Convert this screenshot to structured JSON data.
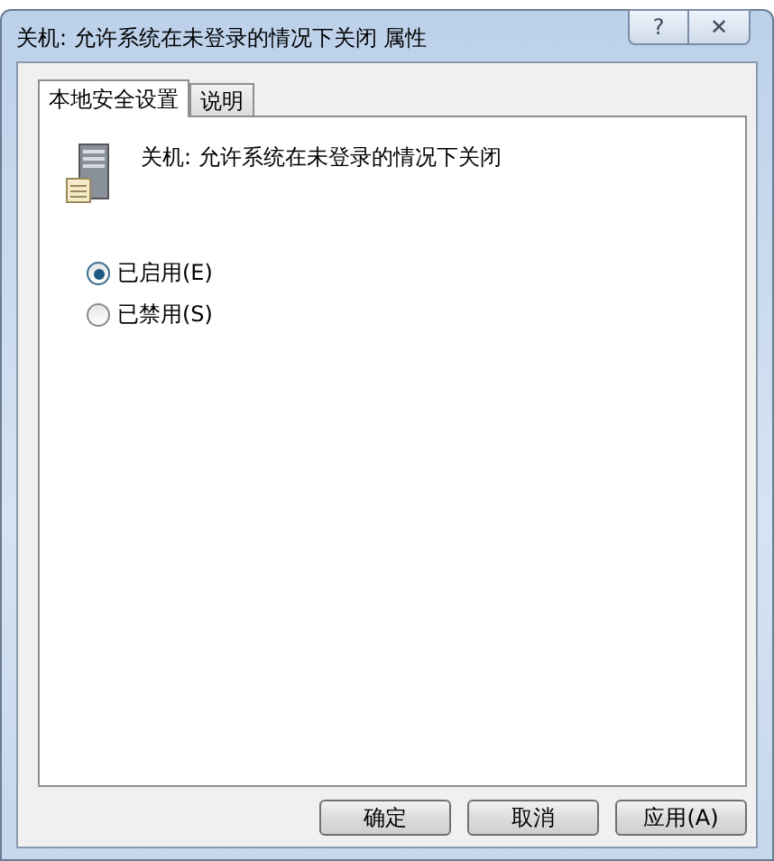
{
  "window": {
    "title": "关机: 允许系统在未登录的情况下关闭 属性",
    "title_buttons": [
      "?",
      "✕"
    ]
  },
  "tabs": [
    {
      "label": "本地安全设置",
      "selected": true
    },
    {
      "label": "说明",
      "selected": false
    }
  ],
  "policy": {
    "name": "关机: 允许系统在未登录的情况下关闭"
  },
  "options": [
    {
      "label": "已启用(E)",
      "selected": true
    },
    {
      "label": "已禁用(S)",
      "selected": false
    }
  ],
  "buttons": [
    {
      "label": "确定",
      "disabled": false
    },
    {
      "label": "取消",
      "disabled": false
    },
    {
      "label": "应用(A)",
      "disabled": false
    }
  ]
}
